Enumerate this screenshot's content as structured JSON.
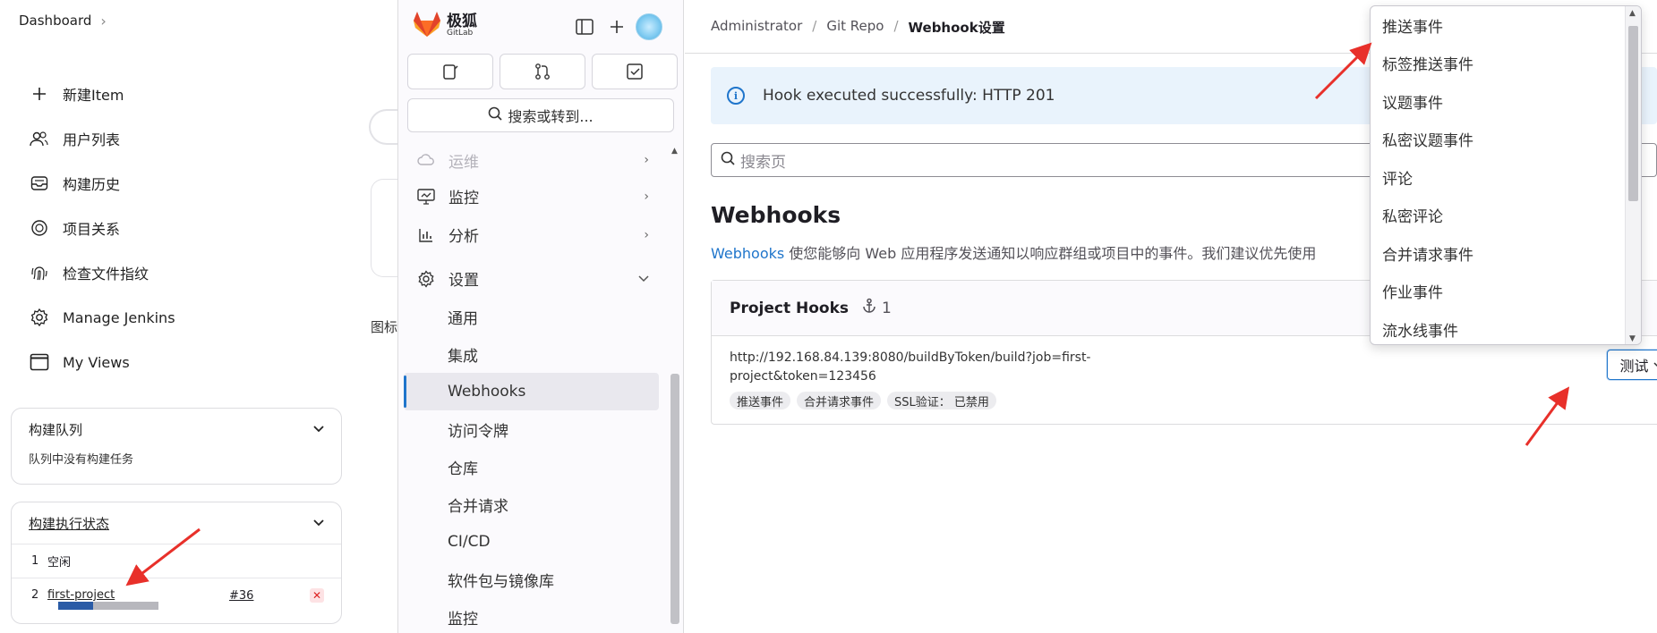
{
  "jenkins": {
    "breadcrumb": "Dashboard",
    "menu": [
      {
        "label": "新建Item",
        "icon": "plus-icon"
      },
      {
        "label": "用户列表",
        "icon": "users-icon"
      },
      {
        "label": "构建历史",
        "icon": "inbox-icon"
      },
      {
        "label": "项目关系",
        "icon": "target-icon"
      },
      {
        "label": "检查文件指纹",
        "icon": "fingerprint-icon"
      },
      {
        "label": "Manage Jenkins",
        "icon": "gear-icon"
      },
      {
        "label": "My Views",
        "icon": "window-icon"
      }
    ],
    "queue": {
      "title": "构建队列",
      "empty": "队列中没有构建任务"
    },
    "executors": {
      "title": "构建执行状态",
      "rows": [
        {
          "num": "1",
          "label": "空闲"
        },
        {
          "num": "2",
          "label": "first-project",
          "build": "#36",
          "progress": 0.35
        }
      ]
    },
    "fragment_text": "图标"
  },
  "gitlab_sidebar": {
    "brand": "极狐",
    "brand_sub": "GitLab",
    "search": "搜索或转到...",
    "nav": [
      {
        "label": "运维",
        "icon": "cloud-icon",
        "faded": true
      },
      {
        "label": "监控",
        "icon": "monitor-icon"
      },
      {
        "label": "分析",
        "icon": "chart-icon"
      },
      {
        "label": "设置",
        "icon": "settings-icon"
      }
    ],
    "settings_sub": [
      "通用",
      "集成",
      "Webhooks",
      "访问令牌",
      "仓库",
      "合并请求",
      "CI/CD",
      "软件包与镜像库",
      "监控"
    ]
  },
  "main": {
    "breadcrumb": [
      "Administrator",
      "Git Repo",
      "Webhook设置"
    ],
    "alert": "Hook executed successfully: HTTP 201",
    "search_placeholder": "搜索页",
    "title": "Webhooks",
    "desc_link": "Webhooks",
    "desc_text": " 使您能够向 Web 应用程序发送通知以响应群组或项目中的事件。我们建议优先使用",
    "hooks": {
      "title": "Project Hooks",
      "count": "1",
      "url": "http://192.168.84.139:8080/buildByToken/build?job=first-project&token=123456",
      "badges": [
        "推送事件",
        "合并请求事件",
        "SSL验证： 已禁用"
      ],
      "test_label": "测试"
    }
  },
  "dropdown": {
    "items": [
      "推送事件",
      "标签推送事件",
      "议题事件",
      "私密议题事件",
      "评论",
      "私密评论",
      "合并请求事件",
      "作业事件",
      "流水线事件"
    ]
  },
  "colors": {
    "accent": "#1f75cb",
    "annotation_arrow": "#e8302a"
  }
}
